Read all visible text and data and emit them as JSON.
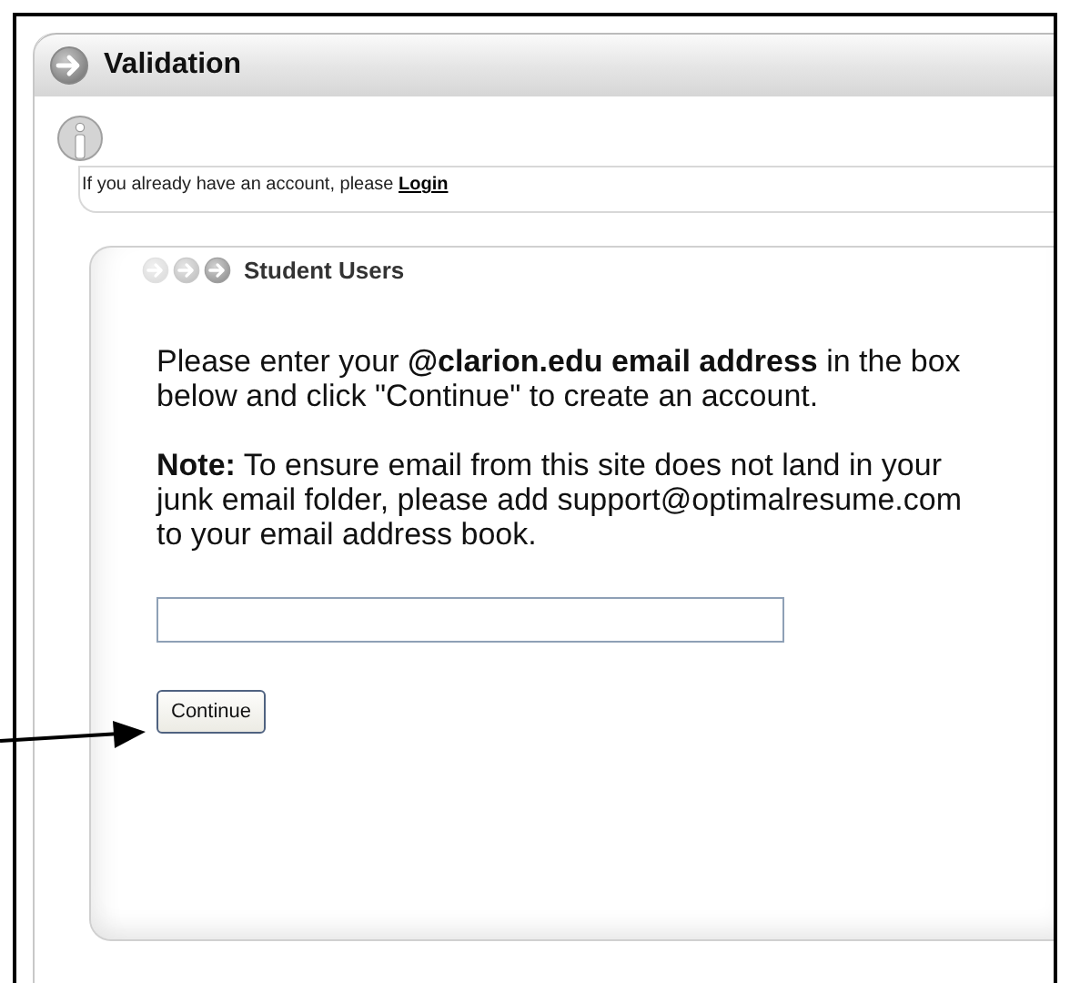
{
  "panel": {
    "title": "Validation"
  },
  "info": {
    "text": "If you already have an account, please ",
    "link": "Login"
  },
  "student_box": {
    "title": "Student Users",
    "paragraphs": [
      "Please enter your **@clarion.edu email address** in the box below and click \"Continue\" to create an account.",
      "**Note:** To ensure email from this site does not land in your junk email folder, please add support@optimalresume.com to your email address book."
    ],
    "button": "Continue"
  }
}
